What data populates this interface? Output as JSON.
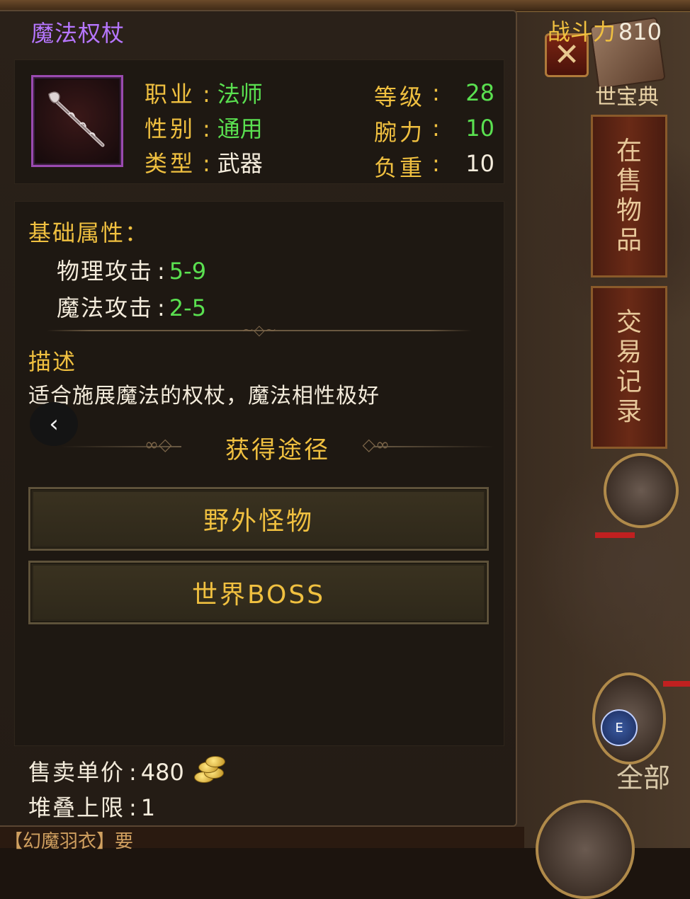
{
  "item": {
    "name": "魔法权杖",
    "power_label": "战斗力",
    "power_value": "810",
    "icon": "staff-icon",
    "name_color": "#b676ff"
  },
  "basic_info": {
    "profession_label": "职业",
    "profession_value": "法师",
    "gender_label": "性别",
    "gender_value": "通用",
    "type_label": "类型",
    "type_value": "武器",
    "level_label": "等级",
    "level_value": "28",
    "strength_label": "腕力",
    "strength_value": "10",
    "weight_label": "负重",
    "weight_value": "10",
    "separator": ":"
  },
  "attributes": {
    "title": "基础属性：",
    "physical_label": "物理攻击",
    "physical_value": "5-9",
    "magic_label": "魔法攻击",
    "magic_value": "2-5",
    "separator": ":"
  },
  "description": {
    "title": "描述",
    "text": "适合施展魔法的权杖，魔法相性极好"
  },
  "sources": {
    "title": "获得途径",
    "buttons": [
      "野外怪物",
      "世界BOSS"
    ]
  },
  "footer": {
    "price_label": "售卖单价",
    "price_value": "480",
    "stack_label": "堆叠上限",
    "stack_value": "1",
    "separator": ":"
  },
  "background": {
    "close_icon": "close-icon",
    "book_title": "世宝典",
    "tab_on_sale": [
      "在",
      "售",
      "物",
      "品"
    ],
    "tab_trade_log": [
      "交",
      "易",
      "记",
      "录"
    ],
    "bottom_text": "全部",
    "e_badge": "E",
    "bottom_strip": "【幻魔羽衣】要"
  },
  "colors": {
    "gold": "#f0c040",
    "green": "#5ae050",
    "white": "#f4ecdc",
    "purple": "#b676ff"
  }
}
